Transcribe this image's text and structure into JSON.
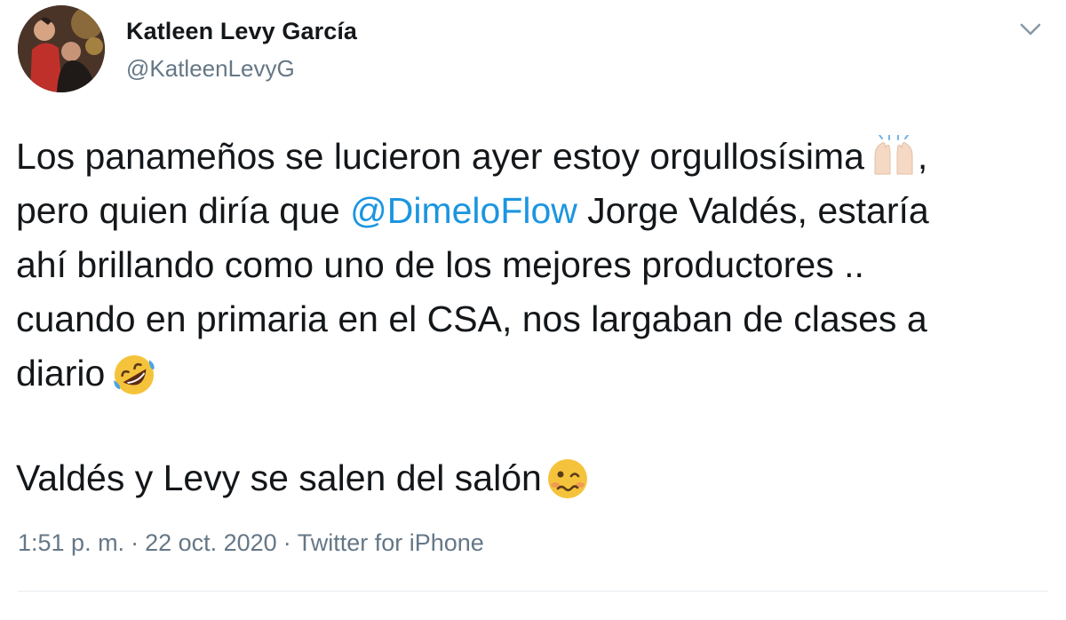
{
  "tweet": {
    "author": {
      "display_name": "Katleen Levy García",
      "handle": "@KatleenLevyG"
    },
    "text_part1": "Los panameños se lucieron ayer estoy orgullosísima",
    "text_part2": ",\npero quien diría que ",
    "mention": "@DimeloFlow",
    "text_part3": " Jorge Valdés, estaría\nahí brillando como uno de los  mejores productores ..\ncuando en primaria en el CSA, nos largaban de clases a\ndiario",
    "text_part4": "Valdés y Levy se salen del salón",
    "emojis": [
      "raising-hands-icon",
      "rolling-on-floor-laughing-icon",
      "woozy-face-icon"
    ],
    "meta": {
      "time": "1:51 p. m.",
      "separator": "·",
      "date": "22 oct. 2020",
      "source": "Twitter for iPhone"
    }
  },
  "colors": {
    "text": "#14171a",
    "secondary": "#657786",
    "link": "#1b95e0",
    "divider": "#e6ecf0"
  }
}
